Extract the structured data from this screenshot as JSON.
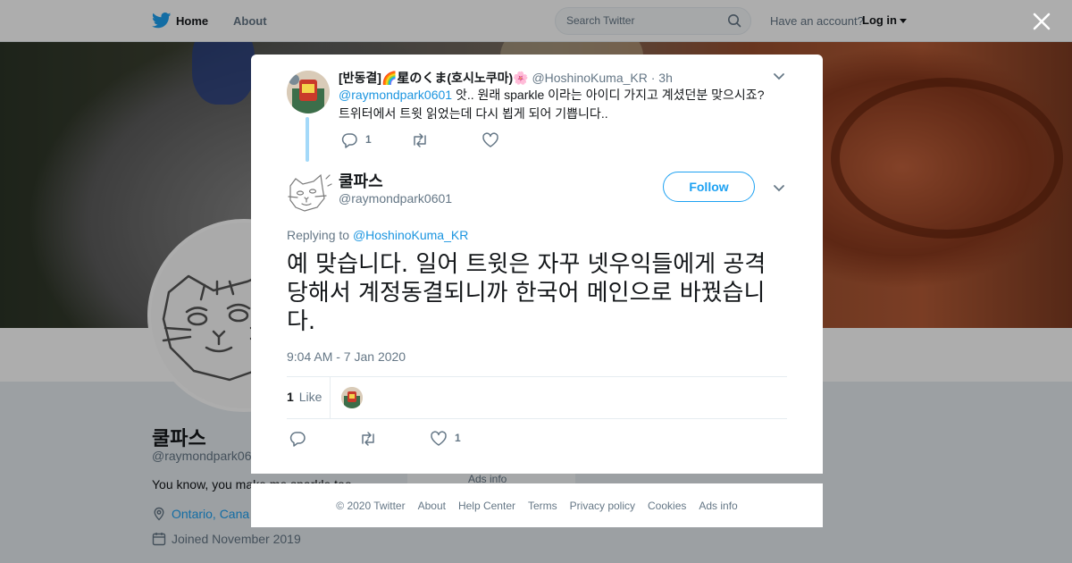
{
  "topnav": {
    "home_label": "Home",
    "about_label": "About",
    "search_placeholder": "Search Twitter",
    "have_account": "Have an account?",
    "login_label": "Log in"
  },
  "profile": {
    "name": "쿨파스",
    "handle": "@raymondpark06",
    "bio": "You know, you make me sparkle too.",
    "location": "Ontario, Cana",
    "joined": "Joined November 2019",
    "ads_info": "Ads info"
  },
  "parent_tweet": {
    "name": "[반동결]🌈星のくま(호시노쿠마)🌸",
    "handle": "@HoshinoKuma_KR",
    "separator": "·",
    "time": "3h",
    "mention": "@raymondpark0601",
    "text": " 앗.. 원래 sparkle 이라는 아이디 가지고 계셨던분 맞으시죠? 트위터에서 트윗 읽었는데 다시 뵙게 되어 기쁩니다..",
    "reply_count": "1"
  },
  "main_tweet": {
    "name": "쿨파스",
    "handle": "@raymondpark0601",
    "follow_label": "Follow",
    "replying_label": "Replying to",
    "replying_to": "@HoshinoKuma_KR",
    "text": "예 맞습니다. 일어 트윗은 자꾸 넷우익들에게 공격당해서 계정동결되니까 한국어 메인으로 바꿨습니다.",
    "datetime": "9:04 AM - 7 Jan 2020",
    "like_count": "1",
    "like_label": "Like",
    "action_like_count": "1"
  },
  "footer": {
    "items": [
      "© 2020 Twitter",
      "About",
      "Help Center",
      "Terms",
      "Privacy policy",
      "Cookies",
      "Ads info"
    ]
  },
  "colors": {
    "accent": "#1da1f2",
    "link": "#1b95e0",
    "text": "#14171a",
    "muted": "#657786",
    "thread_line": "#a4d9f9"
  },
  "icons": [
    "twitter-bird-icon",
    "search-icon",
    "close-icon",
    "chevron-down-icon",
    "reply-icon",
    "retweet-icon",
    "heart-icon",
    "location-icon",
    "calendar-icon"
  ]
}
